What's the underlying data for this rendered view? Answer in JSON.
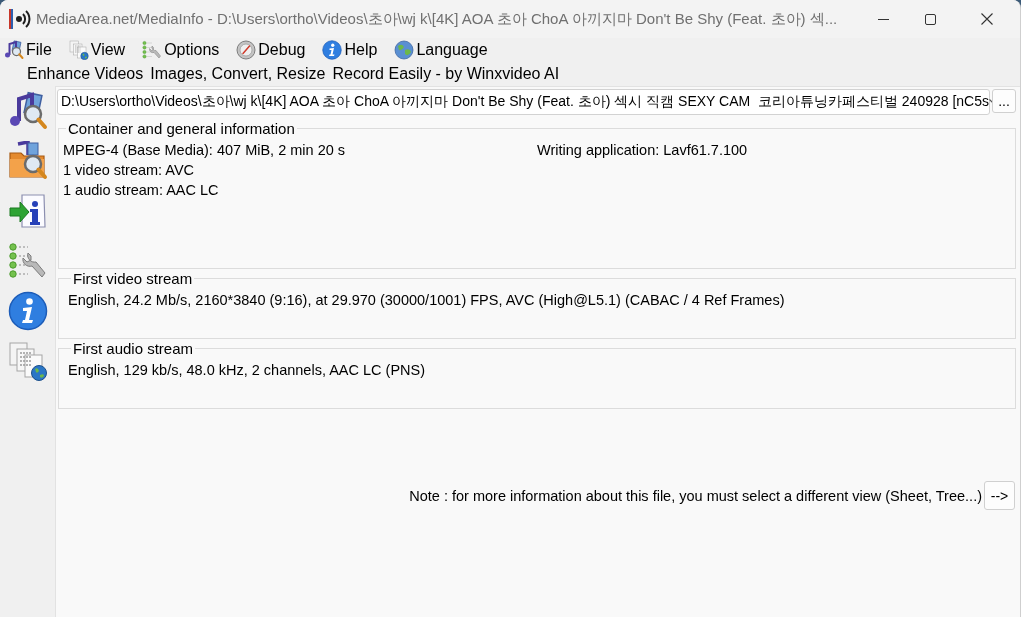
{
  "window": {
    "title": "MediaArea.net/MediaInfo - D:\\Users\\ortho\\Videos\\초아\\wj k\\[4K] AOA 초아 ChoA 아끼지마 Don't Be Shy (Feat. 초아) 섹..."
  },
  "menu": [
    {
      "label": "File"
    },
    {
      "label": "View"
    },
    {
      "label": "Options"
    },
    {
      "label": "Debug"
    },
    {
      "label": "Help"
    },
    {
      "label": "Language"
    }
  ],
  "promo_links": [
    "Enhance Videos",
    "Images, Convert, Resize",
    "Record Easily - by Winxvideo AI"
  ],
  "file_selector": {
    "value": "D:\\Users\\ortho\\Videos\\초아\\wj k\\[4K] AOA 초아 ChoA 아끼지마 Don't Be Shy (Feat. 초아) 섹시 직캠 SEXY CAM  코리아튜닝카페스티벌 240928 [nC5s",
    "browse_button": "..."
  },
  "sections": [
    {
      "title": "Container and general information",
      "columns": [
        [
          "MPEG-4 (Base Media): 407 MiB, 2 min 20 s",
          "1 video stream: AVC",
          "1 audio stream: AAC LC"
        ],
        [
          "Writing application: Lavf61.7.100"
        ]
      ]
    },
    {
      "title": "First video stream",
      "columns": [
        [
          "English, 24.2 Mb/s, 2160*3840 (9:16), at 29.970 (30000/1001) FPS, AVC (High@L5.1) (CABAC / 4 Ref Frames)"
        ]
      ]
    },
    {
      "title": "First audio stream",
      "columns": [
        [
          "English, 129 kb/s, 48.0 kHz, 2 channels, AAC LC (PNS)"
        ]
      ]
    }
  ],
  "note": {
    "text": "Note : for more information about this file, you must select a different view (Sheet, Tree...)",
    "button": "-->"
  }
}
